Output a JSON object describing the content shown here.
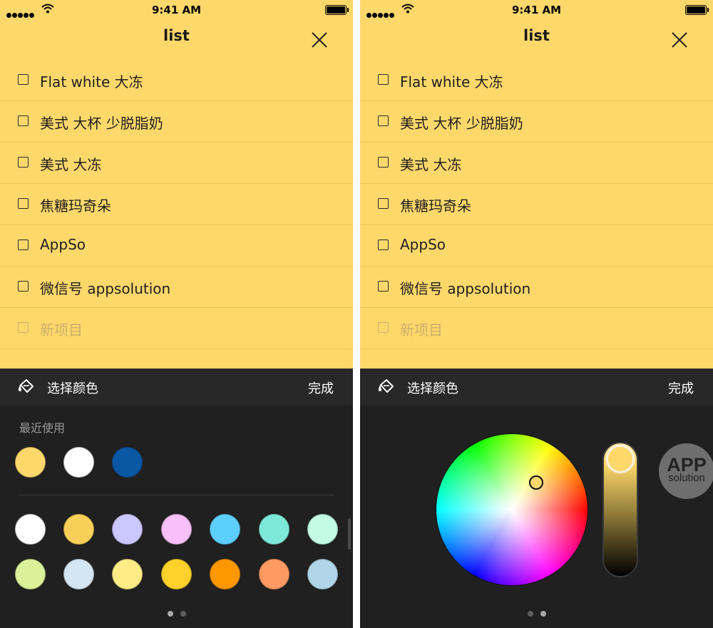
{
  "status_bar": {
    "time": "9:41 AM"
  },
  "note": {
    "title": "list",
    "items": [
      {
        "label": "Flat white 大冻",
        "checked": false
      },
      {
        "label": "美式 大杯 少脱脂奶",
        "checked": false
      },
      {
        "label": "美式 大冻",
        "checked": false
      },
      {
        "label": "焦糖玛奇朵",
        "checked": false
      },
      {
        "label": "AppSo",
        "checked": false
      },
      {
        "label": "微信号 appsolution",
        "checked": false
      }
    ],
    "new_item_placeholder": "新项目",
    "background_color": "#FFD86B"
  },
  "picker": {
    "title": "选择颜色",
    "done_label": "完成",
    "recent_label": "最近使用",
    "recent_colors": [
      "#FFD86B",
      "#FFFFFF",
      "#0A57A4"
    ],
    "palette_rows": [
      [
        "#FFFFFF",
        "#F8CF58",
        "#CBC7FF",
        "#F8BFF9",
        "#5DCFFF",
        "#7EE8D8",
        "#C3FBE5"
      ],
      [
        "#D9F29A",
        "#D5E5F2",
        "#FFEC86",
        "#FFD12A",
        "#FF9800",
        "#FF9A62",
        "#B0D5E8"
      ]
    ],
    "page_count": 2,
    "left_active_page": 0,
    "right_active_page": 1,
    "selected_color": "#FFD86B"
  },
  "watermark": {
    "big": "APP",
    "small": "solution"
  },
  "icons": [
    "signal-icon",
    "wifi-icon",
    "battery-icon",
    "close-icon",
    "paint-bucket-icon",
    "color-wheel",
    "brightness-slider"
  ]
}
